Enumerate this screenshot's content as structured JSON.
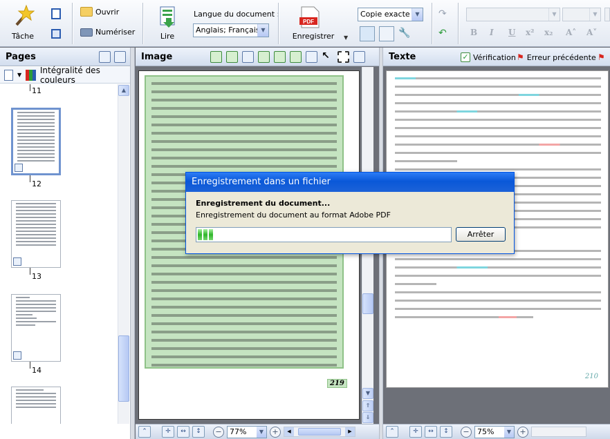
{
  "toolbar": {
    "task_label": "Tâche",
    "open_label": "Ouvrir",
    "scan_label": "Numériser",
    "read_label": "Lire",
    "language_label": "Langue du document :",
    "language_value": "Anglais; Français",
    "save_label": "Enregistrer",
    "save_icon_text": "PDF",
    "save_mode_value": "Copie exacte",
    "format_buttons": [
      "B",
      "I",
      "U",
      "x²",
      "x₂",
      "A˄",
      "A˅"
    ]
  },
  "pages_panel": {
    "title": "Pages",
    "color_mode": "Intégralité des couleurs",
    "page_numbers": [
      "11",
      "12",
      "13",
      "14"
    ],
    "selected_page": "12"
  },
  "image_panel": {
    "title": "Image",
    "zoom": "77%",
    "page_number_label": "219"
  },
  "text_panel": {
    "title": "Texte",
    "verify_label": "Vérification",
    "prev_error_label": "Erreur précédente",
    "zoom": "75%",
    "page_number_label": "210"
  },
  "dialog": {
    "title": "Enregistrement dans un fichier",
    "heading": "Enregistrement du document...",
    "message": "Enregistrement du document au format Adobe PDF",
    "stop_label": "Arrêter",
    "progress_fraction": 0.06
  },
  "colors": {
    "accent": "#0a58d8",
    "ocr_zone": "#c5e4c1",
    "pdf_red": "#d8261f",
    "progress_green": "#2fb52a"
  }
}
